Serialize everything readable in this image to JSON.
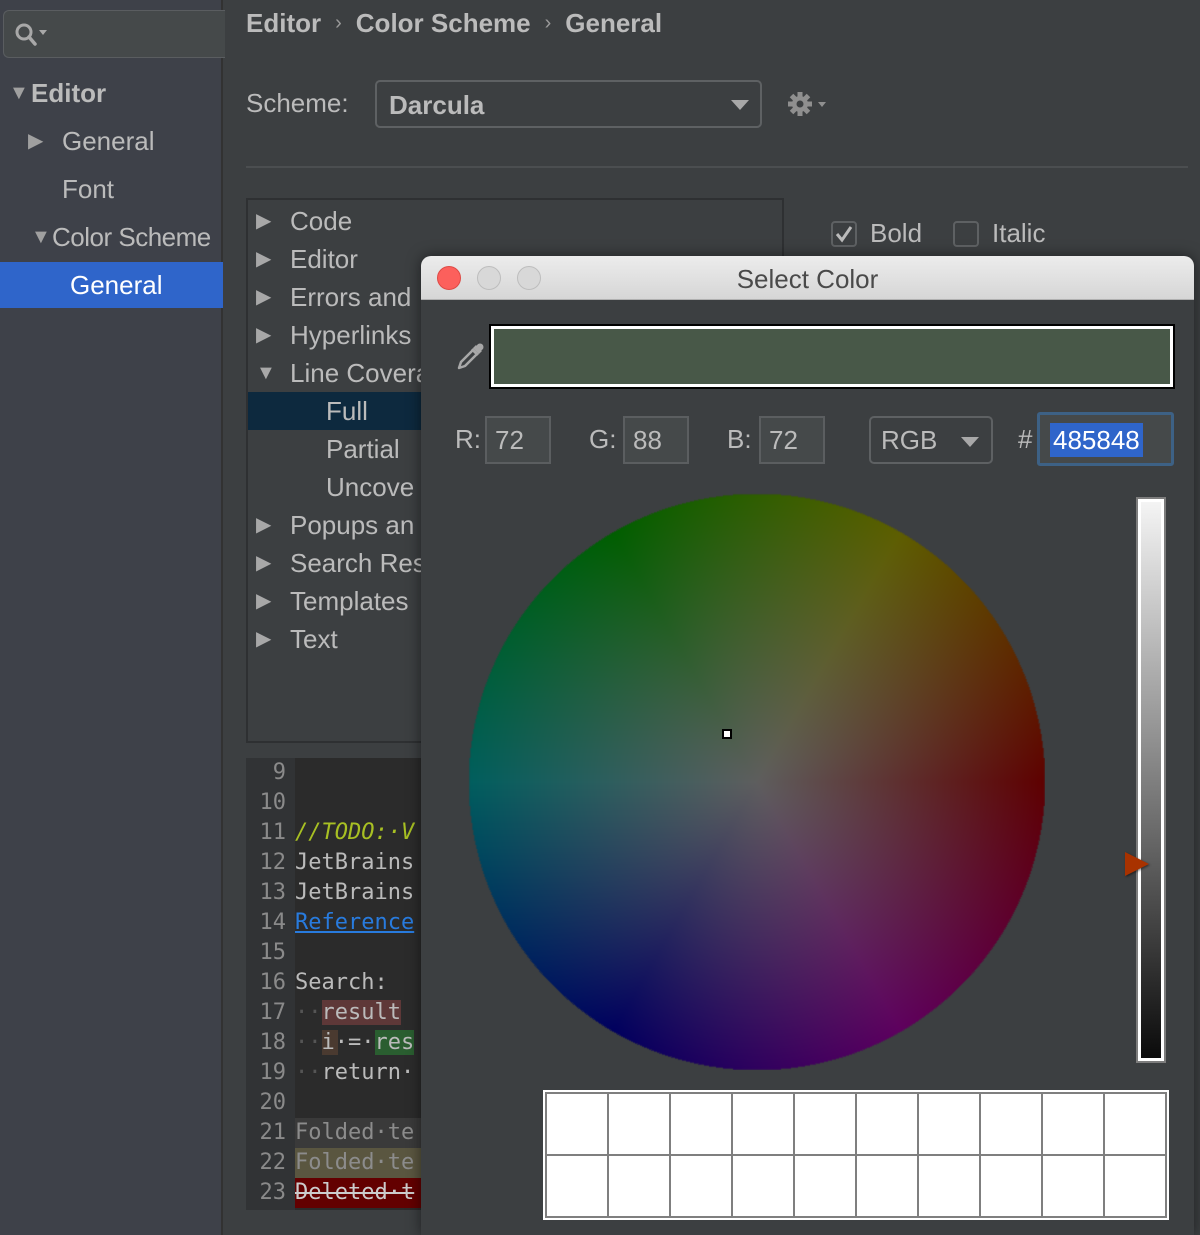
{
  "sidebar": {
    "search": {
      "icon": "search-icon",
      "value": ""
    },
    "items": [
      {
        "label": "Editor",
        "expanded": true,
        "level": 0
      },
      {
        "label": "General",
        "expanded": false,
        "level": 1
      },
      {
        "label": "Font",
        "level": 1
      },
      {
        "label": "Color Scheme",
        "expanded": true,
        "level": 1
      },
      {
        "label": "General",
        "level": 2,
        "selected": true
      }
    ]
  },
  "breadcrumb": [
    "Editor",
    "Color Scheme",
    "General"
  ],
  "breadcrumb_separator": "›",
  "scheme": {
    "label": "Scheme:",
    "value": "Darcula"
  },
  "categories": [
    {
      "label": "Code",
      "expanded": false
    },
    {
      "label": "Editor",
      "expanded": false
    },
    {
      "label": "Errors and",
      "expanded": false
    },
    {
      "label": "Hyperlinks",
      "expanded": false
    },
    {
      "label": "Line Covera",
      "expanded": true
    },
    {
      "label": "Full",
      "child": true,
      "selected": true
    },
    {
      "label": "Partial",
      "child": true
    },
    {
      "label": "Uncove",
      "child": true
    },
    {
      "label": "Popups an",
      "expanded": false
    },
    {
      "label": "Search Res",
      "expanded": false
    },
    {
      "label": "Templates",
      "expanded": false
    },
    {
      "label": "Text",
      "expanded": false
    }
  ],
  "font_style": {
    "bold": {
      "label": "Bold",
      "checked": true
    },
    "italic": {
      "label": "Italic",
      "checked": false
    }
  },
  "preview": {
    "lines": [
      {
        "n": "9",
        "text": ""
      },
      {
        "n": "10",
        "text": ""
      },
      {
        "n": "11",
        "text": "//TODO:·V",
        "style": "todo"
      },
      {
        "n": "12",
        "text": "JetBrains",
        "style": "plain"
      },
      {
        "n": "13",
        "text": "JetBrains",
        "style": "plain"
      },
      {
        "n": "14",
        "text": "Reference",
        "style": "link"
      },
      {
        "n": "15",
        "text": ""
      },
      {
        "n": "16",
        "text": "Search:",
        "style": "plain"
      },
      {
        "n": "17",
        "text": "result",
        "indent": "··",
        "style": "search-red"
      },
      {
        "n": "18",
        "text": "i·=·res",
        "indent": "··",
        "style": "search-green"
      },
      {
        "n": "19",
        "text": "return·",
        "indent": "··",
        "style": "plain"
      },
      {
        "n": "20",
        "text": ""
      },
      {
        "n": "21",
        "text": "Folded·te",
        "style": "folded"
      },
      {
        "n": "22",
        "text": "Folded·te",
        "style": "folded2"
      },
      {
        "n": "23",
        "text": "Deleted·t",
        "style": "deleted"
      }
    ]
  },
  "dialog": {
    "title": "Select Color",
    "preview_color": "#485848",
    "r_label": "R:",
    "r": "72",
    "g_label": "G:",
    "g": "88",
    "b_label": "B:",
    "b": "72",
    "mode": "RGB",
    "hex_label": "#",
    "hex": "485848",
    "brightness_fraction": 0.35,
    "recent_colors_count": 20
  },
  "colors": {
    "accent": "#2f65ca",
    "close_button": "#fc605c",
    "brightness_thumb": "#a83200"
  }
}
